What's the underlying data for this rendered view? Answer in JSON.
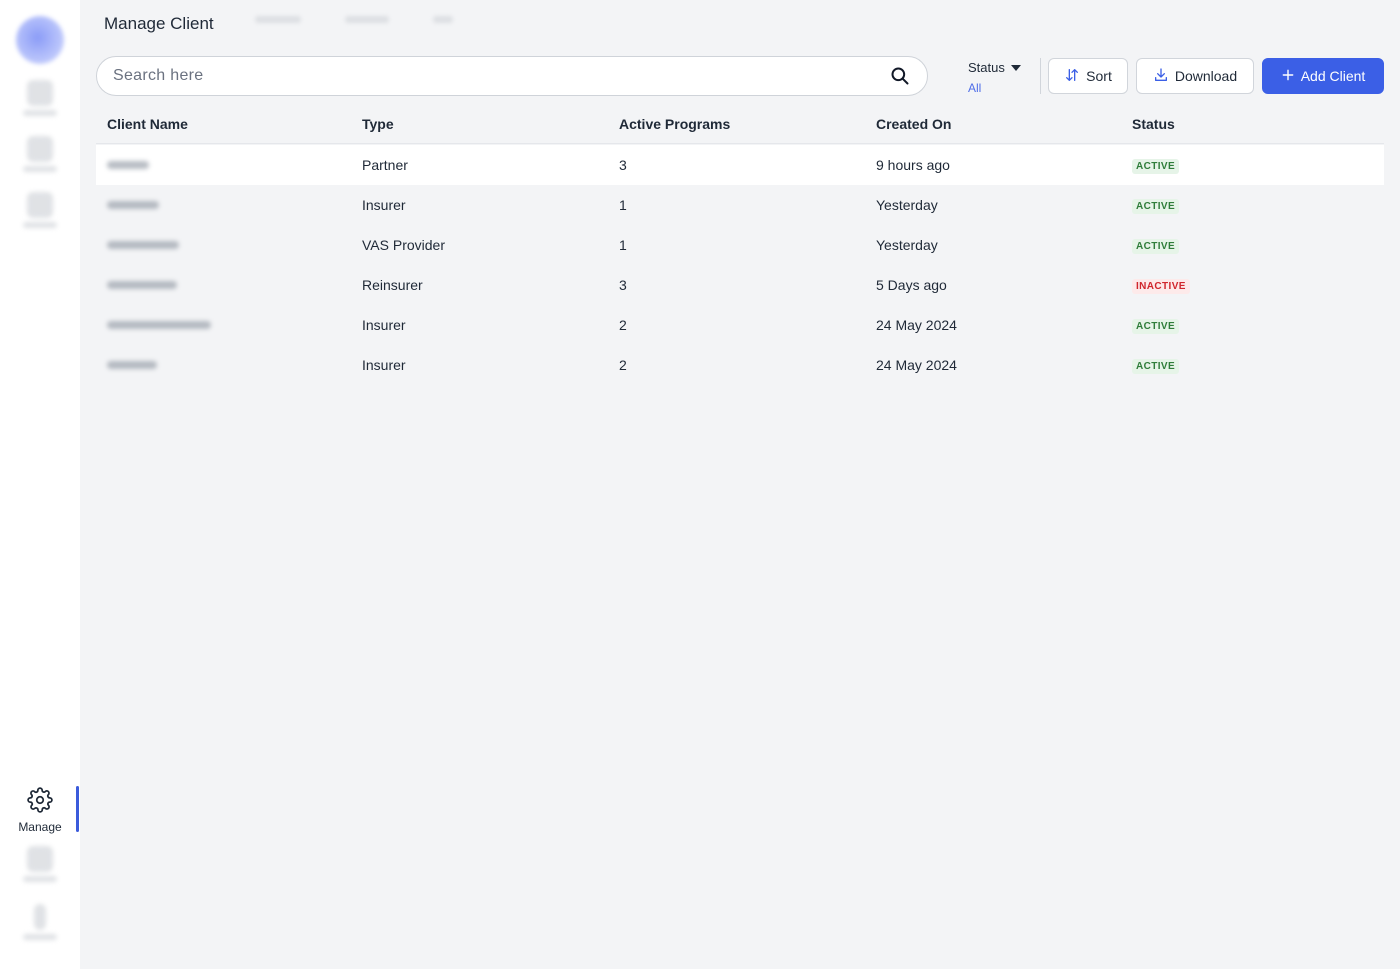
{
  "sidebar": {
    "manage_label": "Manage"
  },
  "header": {
    "title": "Manage Client"
  },
  "search": {
    "placeholder": "Search here",
    "value": ""
  },
  "filter": {
    "label": "Status",
    "value": "All"
  },
  "toolbar": {
    "sort_label": "Sort",
    "download_label": "Download",
    "add_label": "Add Client"
  },
  "table": {
    "columns": [
      "Client Name",
      "Type",
      "Active Programs",
      "Created On",
      "Status"
    ],
    "rows": [
      {
        "type": "Partner",
        "programs": "3",
        "created": "9 hours ago",
        "status": "ACTIVE"
      },
      {
        "type": "Insurer",
        "programs": "1",
        "created": "Yesterday",
        "status": "ACTIVE"
      },
      {
        "type": "VAS Provider",
        "programs": "1",
        "created": "Yesterday",
        "status": "ACTIVE"
      },
      {
        "type": "Reinsurer",
        "programs": "3",
        "created": "5 Days ago",
        "status": "INACTIVE"
      },
      {
        "type": "Insurer",
        "programs": "2",
        "created": "24 May 2024",
        "status": "ACTIVE"
      },
      {
        "type": "Insurer",
        "programs": "2",
        "created": "24 May 2024",
        "status": "ACTIVE"
      }
    ]
  },
  "colors": {
    "accent": "#3b5fe6",
    "active": "#2f7d3a",
    "inactive": "#d0262d"
  }
}
